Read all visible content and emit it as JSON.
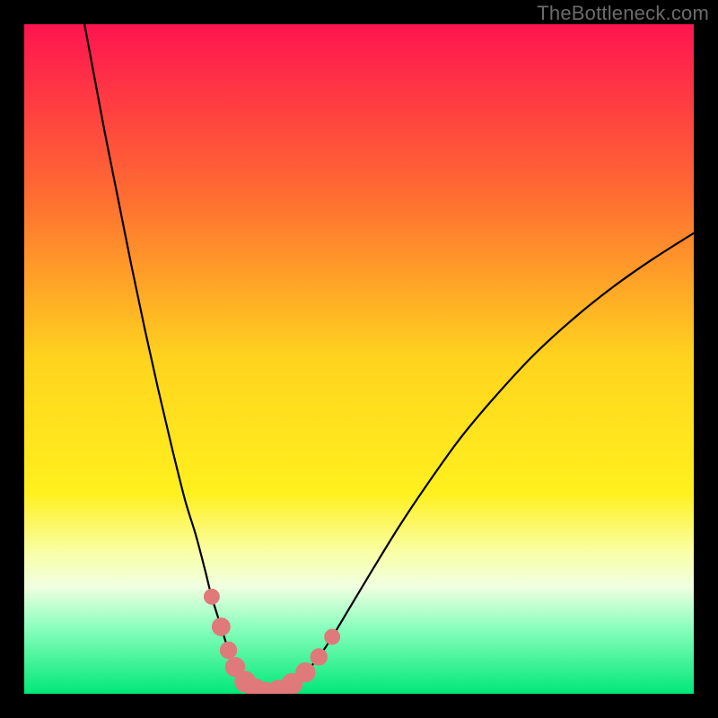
{
  "watermark": "TheBottleneck.com",
  "chart_data": {
    "type": "line",
    "title": "",
    "xlabel": "",
    "ylabel": "",
    "xlim": [
      0,
      100
    ],
    "ylim": [
      0,
      100
    ],
    "grid": false,
    "legend": false,
    "background_gradient": {
      "stops": [
        {
          "offset": 0.0,
          "color": "#ff1450"
        },
        {
          "offset": 0.25,
          "color": "#ff6a32"
        },
        {
          "offset": 0.5,
          "color": "#ffd41e"
        },
        {
          "offset": 0.7,
          "color": "#fff01e"
        },
        {
          "offset": 0.79,
          "color": "#f9ffa8"
        },
        {
          "offset": 0.84,
          "color": "#f0ffe0"
        },
        {
          "offset": 0.9,
          "color": "#8cffbe"
        },
        {
          "offset": 1.0,
          "color": "#00e878"
        }
      ]
    },
    "series": [
      {
        "name": "left-curve",
        "style": {
          "stroke": "#000",
          "width": 2.2
        },
        "points": [
          {
            "x": 9.0,
            "y": 100.0
          },
          {
            "x": 10.5,
            "y": 92.0
          },
          {
            "x": 12.0,
            "y": 84.0
          },
          {
            "x": 14.0,
            "y": 74.0
          },
          {
            "x": 16.0,
            "y": 64.0
          },
          {
            "x": 18.0,
            "y": 54.5
          },
          {
            "x": 20.0,
            "y": 45.5
          },
          {
            "x": 22.0,
            "y": 37.0
          },
          {
            "x": 24.0,
            "y": 29.0
          },
          {
            "x": 25.6,
            "y": 23.8
          },
          {
            "x": 27.0,
            "y": 18.5
          },
          {
            "x": 28.0,
            "y": 14.5
          },
          {
            "x": 29.4,
            "y": 10.0
          },
          {
            "x": 30.5,
            "y": 6.5
          },
          {
            "x": 31.5,
            "y": 4.0
          },
          {
            "x": 33.0,
            "y": 1.8
          },
          {
            "x": 34.5,
            "y": 0.7
          },
          {
            "x": 36.0,
            "y": 0.2
          }
        ]
      },
      {
        "name": "right-curve",
        "style": {
          "stroke": "#000",
          "width": 2.2
        },
        "points": [
          {
            "x": 36.0,
            "y": 0.2
          },
          {
            "x": 38.0,
            "y": 0.5
          },
          {
            "x": 40.0,
            "y": 1.5
          },
          {
            "x": 42.0,
            "y": 3.2
          },
          {
            "x": 44.0,
            "y": 5.5
          },
          {
            "x": 46.0,
            "y": 8.5
          },
          {
            "x": 49.0,
            "y": 13.5
          },
          {
            "x": 52.0,
            "y": 18.5
          },
          {
            "x": 56.0,
            "y": 25.0
          },
          {
            "x": 60.0,
            "y": 31.0
          },
          {
            "x": 65.0,
            "y": 38.0
          },
          {
            "x": 70.0,
            "y": 44.0
          },
          {
            "x": 76.0,
            "y": 50.5
          },
          {
            "x": 82.0,
            "y": 56.0
          },
          {
            "x": 88.0,
            "y": 60.8
          },
          {
            "x": 94.0,
            "y": 65.0
          },
          {
            "x": 100.0,
            "y": 68.8
          }
        ]
      }
    ],
    "markers": [
      {
        "x": 28.0,
        "y": 14.5,
        "r": 1.2,
        "color": "#e07a7a"
      },
      {
        "x": 29.4,
        "y": 10.0,
        "r": 1.4,
        "color": "#e07a7a"
      },
      {
        "x": 30.5,
        "y": 6.5,
        "r": 1.3,
        "color": "#e07a7a"
      },
      {
        "x": 31.5,
        "y": 4.0,
        "r": 1.5,
        "color": "#e07a7a"
      },
      {
        "x": 33.0,
        "y": 1.8,
        "r": 1.6,
        "color": "#e07a7a"
      },
      {
        "x": 34.5,
        "y": 0.7,
        "r": 1.6,
        "color": "#e07a7a"
      },
      {
        "x": 36.0,
        "y": 0.2,
        "r": 1.6,
        "color": "#e07a7a"
      },
      {
        "x": 38.0,
        "y": 0.5,
        "r": 1.6,
        "color": "#e07a7a"
      },
      {
        "x": 40.0,
        "y": 1.5,
        "r": 1.6,
        "color": "#e07a7a"
      },
      {
        "x": 42.0,
        "y": 3.2,
        "r": 1.5,
        "color": "#e07a7a"
      },
      {
        "x": 44.0,
        "y": 5.5,
        "r": 1.3,
        "color": "#e07a7a"
      },
      {
        "x": 46.0,
        "y": 8.5,
        "r": 1.2,
        "color": "#e07a7a"
      }
    ]
  }
}
